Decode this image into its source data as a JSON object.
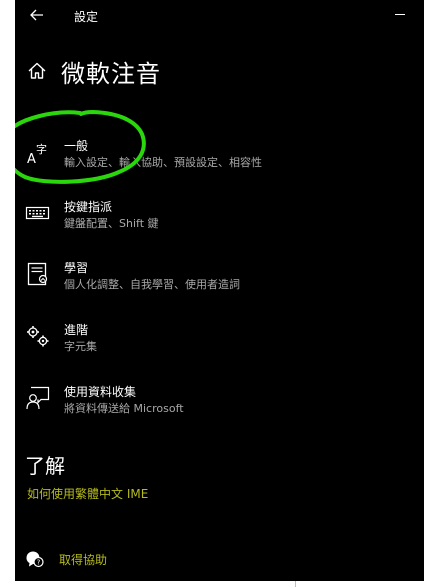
{
  "window": {
    "title": "設定",
    "back_icon": "back-arrow-icon",
    "minimize_icon": "minimize-icon"
  },
  "page": {
    "title": "微軟注音",
    "home_icon": "home-icon"
  },
  "nav_items": [
    {
      "label": "一般",
      "description": "輸入設定、輸入協助、預設設定、相容性",
      "icon": "character-a-icon"
    },
    {
      "label": "按鍵指派",
      "description": "鍵盤配置、Shift 鍵",
      "icon": "keyboard-icon"
    },
    {
      "label": "學習",
      "description": "個人化調整、自我學習、使用者造詞",
      "icon": "learning-book-icon"
    },
    {
      "label": "進階",
      "description": "字元集",
      "icon": "gears-icon"
    },
    {
      "label": "使用資料收集",
      "description": "將資料傳送給 Microsoft",
      "icon": "feedback-user-icon"
    }
  ],
  "section": {
    "title": "了解",
    "link": "如何使用繁體中文 IME"
  },
  "help": {
    "label": "取得協助",
    "icon": "help-chat-icon"
  },
  "colors": {
    "background": "#000000",
    "text": "#ffffff",
    "secondary_text": "#a8a8a8",
    "accent": "#b5ba1f",
    "annotation": "#2bd60c"
  }
}
